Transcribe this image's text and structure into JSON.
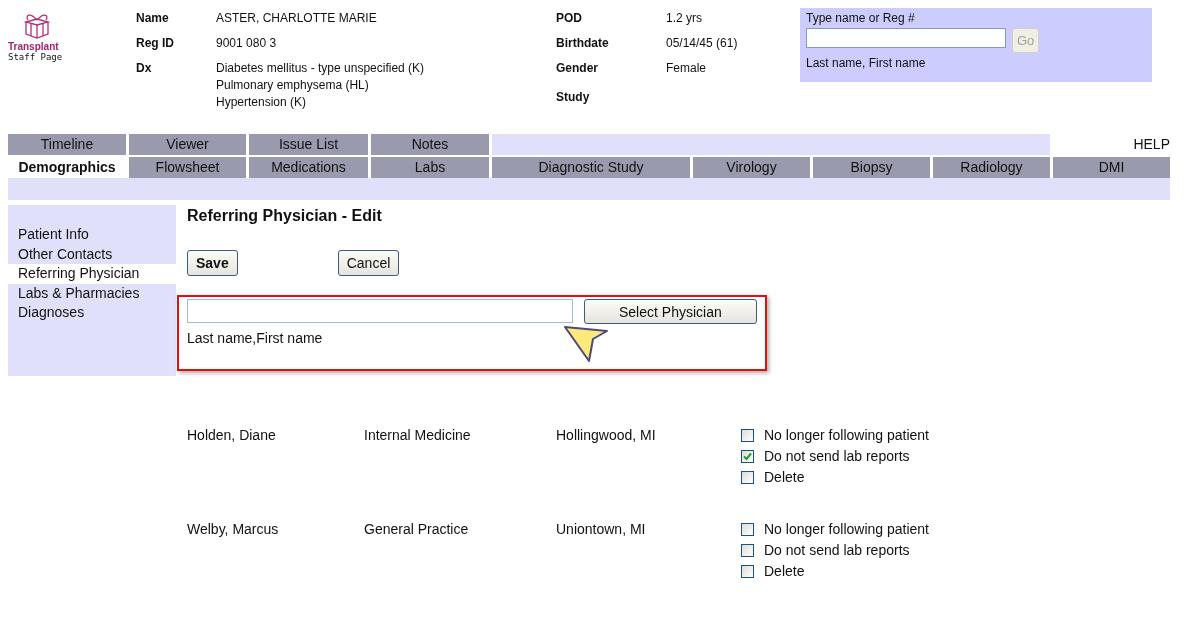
{
  "logo": {
    "title": "Transplant",
    "subtitle": "Staff Page"
  },
  "patient": {
    "left": [
      {
        "label": "Name",
        "lines": [
          "ASTER, CHARLOTTE MARIE"
        ]
      },
      {
        "label": "Reg ID",
        "lines": [
          "9001 080 3"
        ]
      },
      {
        "label": "Dx",
        "lines": [
          "Diabetes mellitus - type unspecified (K)",
          "Pulmonary emphysema (HL)",
          "Hypertension (K)"
        ]
      }
    ],
    "right": [
      {
        "label": "POD",
        "value": "1.2 yrs"
      },
      {
        "label": "Birthdate",
        "value": "05/14/45 (61)"
      },
      {
        "label": "Gender",
        "value": "Female"
      },
      {
        "label": "Study"
      }
    ]
  },
  "search": {
    "label": "Type name or Reg #",
    "button": "Go",
    "button_disabled": true,
    "hint": "Last name, First name"
  },
  "tabs_row_1": [
    {
      "label": "Timeline",
      "selected": false
    },
    {
      "label": "Viewer",
      "selected": false
    },
    {
      "label": "Issue List",
      "selected": false
    },
    {
      "label": "Notes",
      "selected": false
    }
  ],
  "help_link": "HELP",
  "tabs_row_2": [
    {
      "label": "Demographics",
      "selected": true
    },
    {
      "label": "Flowsheet",
      "selected": false
    },
    {
      "label": "Medications",
      "selected": false
    },
    {
      "label": "Labs",
      "selected": false
    },
    {
      "label": "Diagnostic Study",
      "selected": false
    },
    {
      "label": "Virology",
      "selected": false
    },
    {
      "label": "Biopsy",
      "selected": false
    },
    {
      "label": "Radiology",
      "selected": false
    },
    {
      "label": "DMI",
      "selected": false
    }
  ],
  "sidebar": {
    "items": [
      {
        "label": "Patient Info",
        "selected": false
      },
      {
        "label": "Other Contacts",
        "selected": false
      },
      {
        "label": "Referring Physician",
        "selected": true
      },
      {
        "label": "Labs & Pharmacies",
        "selected": false
      },
      {
        "label": "Diagnoses",
        "selected": false
      }
    ]
  },
  "page_title": "Referring Physician - Edit",
  "buttons": {
    "save": "Save",
    "cancel": "Cancel"
  },
  "physician_lookup": {
    "button": "Select Physician",
    "hint": "Last name,First name"
  },
  "physicians": [
    {
      "name": "Holden, Diane",
      "specialty": "Internal Medicine",
      "location": "Hollingwood, MI",
      "options": [
        {
          "label": "No longer following patient",
          "checked": false
        },
        {
          "label": "Do not send lab reports",
          "checked": true
        },
        {
          "label": "Delete",
          "checked": false
        }
      ]
    },
    {
      "name": "Welby, Marcus",
      "specialty": "General Practice",
      "location": "Uniontown, MI",
      "options": [
        {
          "label": "No longer following patient",
          "checked": false
        },
        {
          "label": "Do not send lab reports",
          "checked": false
        },
        {
          "label": "Delete",
          "checked": false
        }
      ]
    }
  ]
}
